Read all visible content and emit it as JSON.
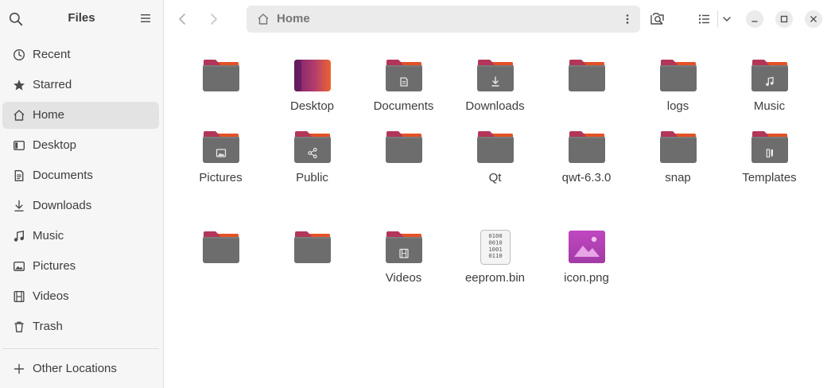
{
  "sidebar": {
    "title": "Files",
    "search_icon": "search-icon",
    "menu_icon": "hamburger-menu-icon",
    "places": [
      {
        "label": "Recent",
        "icon": "clock-icon"
      },
      {
        "label": "Starred",
        "icon": "star-icon"
      },
      {
        "label": "Home",
        "icon": "home-icon",
        "active": true
      },
      {
        "label": "Desktop",
        "icon": "desktop-icon"
      },
      {
        "label": "Documents",
        "icon": "document-icon"
      },
      {
        "label": "Downloads",
        "icon": "download-icon"
      },
      {
        "label": "Music",
        "icon": "music-icon"
      },
      {
        "label": "Pictures",
        "icon": "picture-icon"
      },
      {
        "label": "Videos",
        "icon": "film-icon"
      },
      {
        "label": "Trash",
        "icon": "trash-icon"
      }
    ],
    "other_locations": {
      "label": "Other Locations",
      "icon": "plus-icon"
    }
  },
  "header": {
    "back_icon": "back-arrow-icon",
    "forward_icon": "forward-arrow-icon",
    "path_label": "Home",
    "path_icon": "home-icon",
    "path_menu_icon": "kebab-menu-icon",
    "search_icon": "search-folder-icon",
    "view_icon": "list-view-icon",
    "view_dropdown_icon": "chevron-down-icon",
    "minimize_icon": "minimize-icon",
    "maximize_icon": "maximize-icon",
    "close_icon": "close-icon"
  },
  "colors": {
    "folder_body": "#6d6d6d",
    "folder_tab": "#b23659",
    "folder_accent": "#e95420",
    "selected_bg": "#e3e3e3"
  },
  "files": [
    {
      "name": "",
      "kind": "folder",
      "emblem": ""
    },
    {
      "name": "Desktop",
      "kind": "desktop",
      "emblem": ""
    },
    {
      "name": "Documents",
      "kind": "folder",
      "emblem": "document"
    },
    {
      "name": "Downloads",
      "kind": "folder",
      "emblem": "download"
    },
    {
      "name": "",
      "kind": "folder",
      "emblem": ""
    },
    {
      "name": "logs",
      "kind": "folder",
      "emblem": ""
    },
    {
      "name": "Music",
      "kind": "folder",
      "emblem": "music"
    },
    {
      "name": "Pictures",
      "kind": "folder",
      "emblem": "picture"
    },
    {
      "name": "Public",
      "kind": "folder",
      "emblem": "share"
    },
    {
      "name": "",
      "kind": "folder",
      "emblem": ""
    },
    {
      "name": "Qt",
      "kind": "folder",
      "emblem": ""
    },
    {
      "name": "qwt-6.3.0",
      "kind": "folder",
      "emblem": ""
    },
    {
      "name": "snap",
      "kind": "folder",
      "emblem": ""
    },
    {
      "name": "Templates",
      "kind": "folder",
      "emblem": "template"
    },
    {
      "name": "",
      "kind": "folder",
      "emblem": ""
    },
    {
      "name": "",
      "kind": "folder",
      "emblem": ""
    },
    {
      "name": "Videos",
      "kind": "folder",
      "emblem": "film"
    },
    {
      "name": "eeprom.bin",
      "kind": "binary",
      "emblem": "",
      "binary_text": [
        "0100",
        "0010",
        "1001",
        "0110"
      ]
    },
    {
      "name": "icon.png",
      "kind": "image",
      "emblem": ""
    }
  ]
}
